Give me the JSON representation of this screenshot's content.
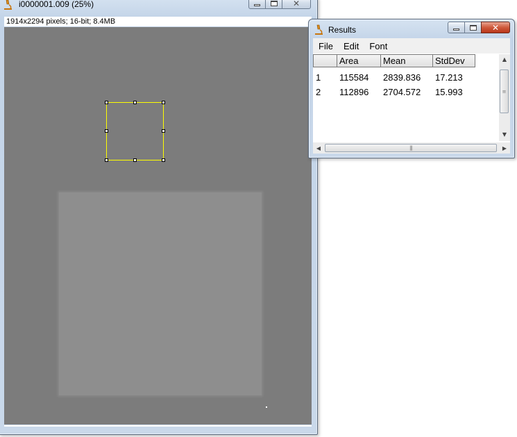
{
  "image_window": {
    "title": "i0000001.009 (25%)",
    "info": "1914x2294 pixels; 16-bit; 8.4MB",
    "icon": "microscope-icon"
  },
  "results_window": {
    "title": "Results",
    "icon": "microscope-icon",
    "menu": [
      "File",
      "Edit",
      "Font"
    ],
    "columns": [
      "",
      "Area",
      "Mean",
      "StdDev"
    ],
    "rows": [
      [
        "1",
        "115584",
        "2839.836",
        "17.213"
      ],
      [
        "2",
        "112896",
        "2704.572",
        "15.993"
      ]
    ]
  },
  "window_controls": {
    "minimize_icon": "minimize-icon",
    "maximize_icon": "maximize-icon",
    "close_icon": "close-icon"
  },
  "colors": {
    "roi": "#ffff00",
    "image_background": "#7c7c7c",
    "bright_region": "#8e8e8e"
  }
}
